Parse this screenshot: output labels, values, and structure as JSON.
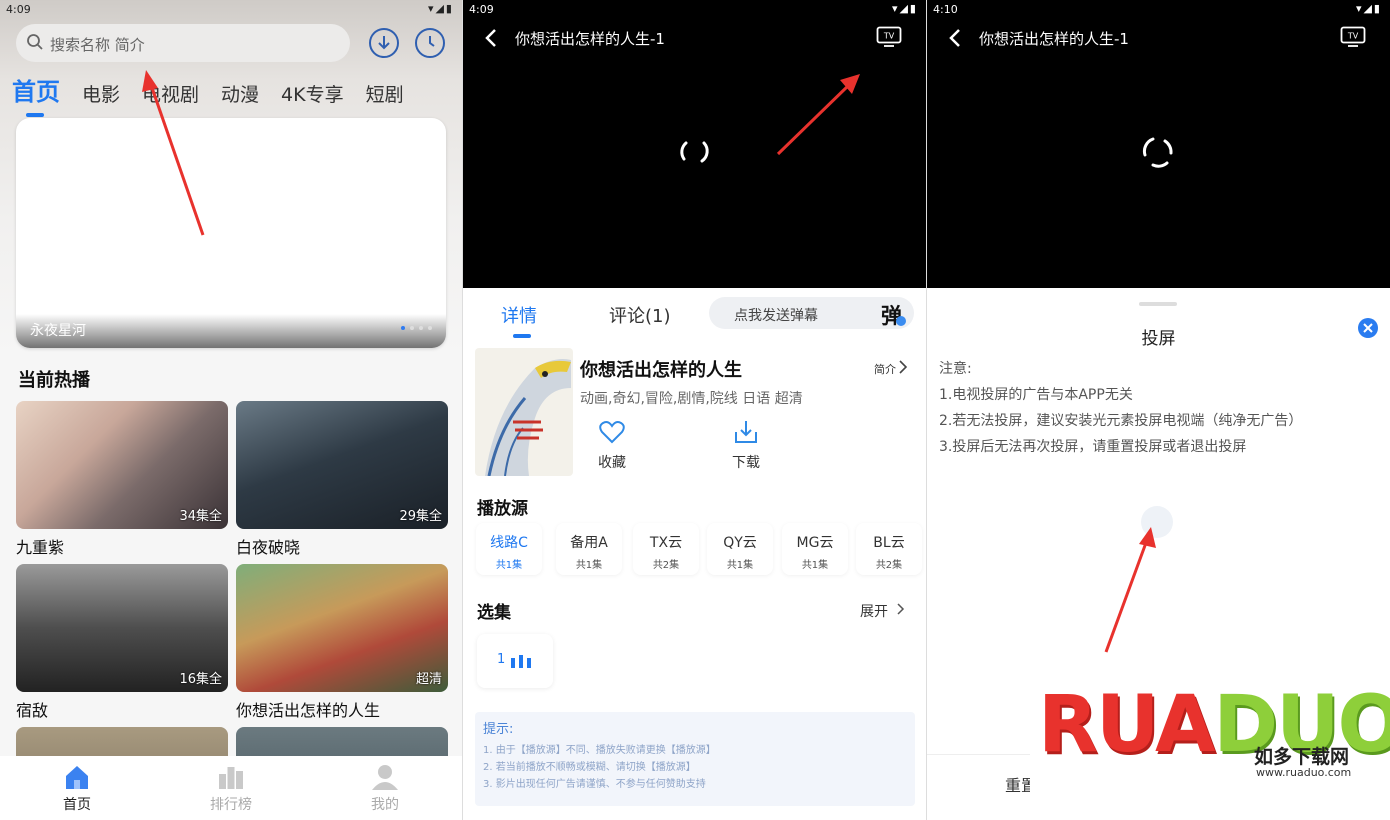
{
  "panel1": {
    "status_time": "4:09",
    "search_placeholder": "搜索名称 简介",
    "tabs": [
      "首页",
      "电影",
      "电视剧",
      "动漫",
      "4K专享",
      "短剧"
    ],
    "banner_caption": "永夜星河",
    "section_title": "当前热播",
    "cards": [
      {
        "name": "九重紫",
        "badge": "34集全"
      },
      {
        "name": "白夜破晓",
        "badge": "29集全"
      },
      {
        "name": "宿敌",
        "badge": "16集全"
      },
      {
        "name": "你想活出怎样的人生",
        "badge": "超清"
      }
    ],
    "nav": [
      "首页",
      "排行榜",
      "我的"
    ]
  },
  "panel2": {
    "status_time": "4:09",
    "video_title": "你想活出怎样的人生-1",
    "tabs": [
      "详情",
      "评论(1)"
    ],
    "danmu_placeholder": "点我发送弹幕",
    "danmu_button": "弹",
    "movie_title": "你想活出怎样的人生",
    "intro_label": "简介",
    "tags": "动画,奇幻,冒险,剧情,院线 日语 超清",
    "actions": [
      "收藏",
      "下载"
    ],
    "source_heading": "播放源",
    "sources": [
      {
        "name": "线路C",
        "count": "共1集"
      },
      {
        "name": "备用A",
        "count": "共1集"
      },
      {
        "name": "TX云",
        "count": "共2集"
      },
      {
        "name": "QY云",
        "count": "共1集"
      },
      {
        "name": "MG云",
        "count": "共1集"
      },
      {
        "name": "BL云",
        "count": "共2集"
      }
    ],
    "episodes_heading": "选集",
    "expand_label": "展开",
    "episode_1": "1",
    "tips_title": "提示:",
    "tips": [
      "1. 由于【播放源】不同、播放失败请更换【播放源】",
      "2. 若当前播放不顺畅或模糊、请切换【播放源】",
      "3. 影片出现任何广告请谨慎、不参与任何赞助支持"
    ]
  },
  "panel3": {
    "status_time": "4:10",
    "video_title": "你想活出怎样的人生-1",
    "sheet_title": "投屏",
    "notes": [
      "注意:",
      "1.电视投屏的广告与本APP无关",
      "2.若无法投屏，建议安装光元素投屏电视端（纯净无广告）",
      "3.投屏后无法再次投屏，请重置投屏或者退出投屏"
    ],
    "reset_partial": "重置"
  },
  "watermark": {
    "logo_text_red": "RUA",
    "logo_text_green": "DUO",
    "name": "如多下载网",
    "url": "www.ruaduo.com"
  },
  "colors": {
    "accent": "#1f78f0",
    "arrow": "#e8322d"
  }
}
